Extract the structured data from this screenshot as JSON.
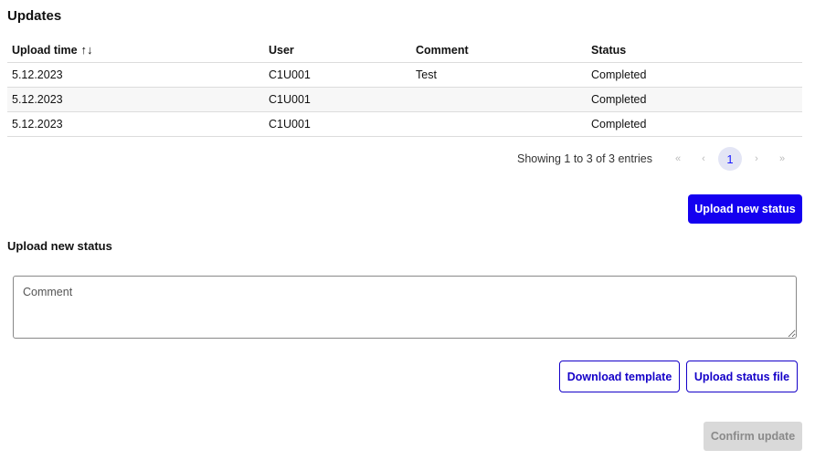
{
  "header": {
    "title": "Updates"
  },
  "table": {
    "columns": [
      {
        "label": "Upload time",
        "sort_icon": "↑↓"
      },
      {
        "label": "User"
      },
      {
        "label": "Comment"
      },
      {
        "label": "Status"
      }
    ],
    "rows": [
      {
        "upload_time": "5.12.2023",
        "user": "C1U001",
        "comment": "Test",
        "status": "Completed"
      },
      {
        "upload_time": "5.12.2023",
        "user": "C1U001",
        "comment": "",
        "status": "Completed"
      },
      {
        "upload_time": "5.12.2023",
        "user": "C1U001",
        "comment": "",
        "status": "Completed"
      }
    ]
  },
  "pagination": {
    "info": "Showing 1 to 3 of 3 entries",
    "first_icon": "«",
    "prev_icon": "‹",
    "current_page": "1",
    "next_icon": "›",
    "last_icon": "»"
  },
  "actions": {
    "upload_new_status_label": "Upload new status"
  },
  "upload_section": {
    "title": "Upload new status",
    "comment_placeholder": "Comment",
    "comment_value": "",
    "download_template_label": "Download template",
    "upload_file_label": "Upload status file",
    "confirm_label": "Confirm update"
  },
  "colors": {
    "primary": "#1400f0",
    "disabled_bg": "#d9d9d9",
    "page_active_bg": "#e3e5f5"
  }
}
